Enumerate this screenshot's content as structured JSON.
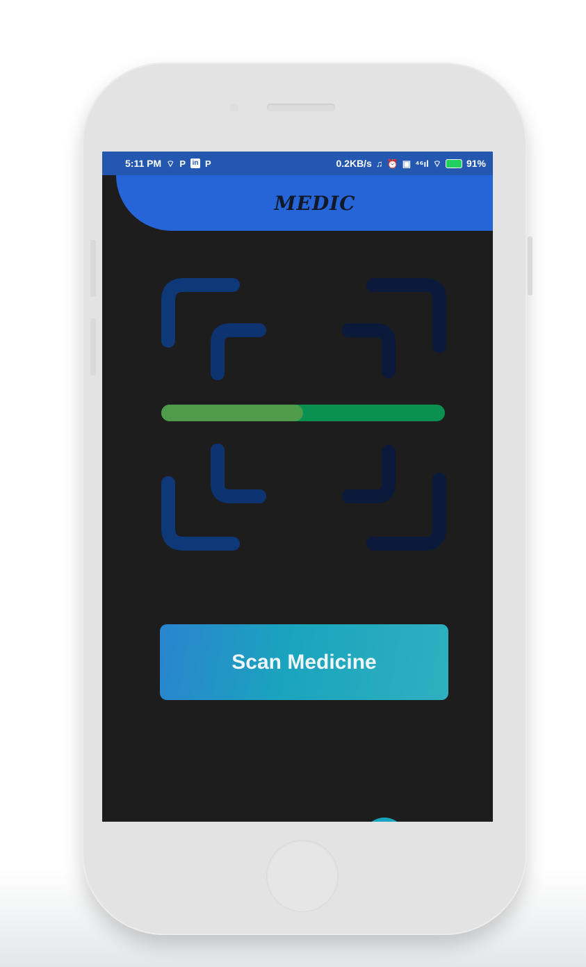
{
  "status_bar": {
    "time": "5:11 PM",
    "left_icons": [
      "wifi-icon",
      "parking-icon",
      "linkedin-icon",
      "parking-icon"
    ],
    "left_glyphs": [
      "⌔",
      "P",
      "in",
      "P"
    ],
    "network_speed": "0.2KB/s",
    "right_glyphs": [
      "♫",
      "⏰",
      "▣",
      "⁴⁶ıl",
      "⌔"
    ],
    "battery": "91%"
  },
  "header": {
    "title": "MEDIC"
  },
  "scanner": {
    "progress": 0.5,
    "colors": {
      "frame_outer_left": "#0f3879",
      "frame_outer_right": "#0b1a3a",
      "bar_left": "#4f9b4c",
      "bar_right": "#0a9152"
    }
  },
  "actions": {
    "scan_label": "Scan Medicine"
  }
}
